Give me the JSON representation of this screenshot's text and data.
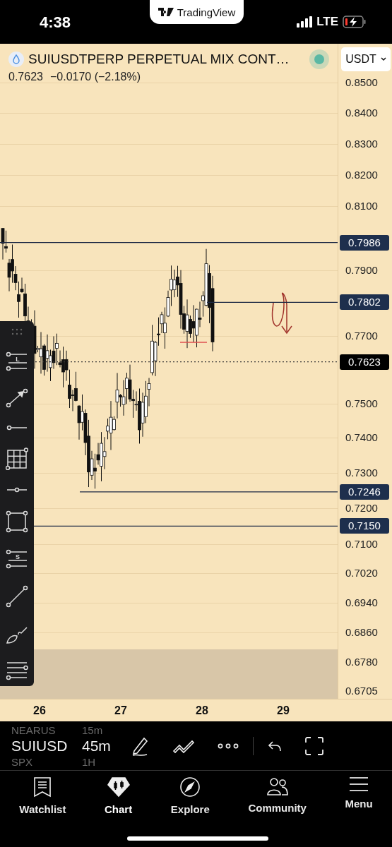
{
  "status_bar": {
    "time": "4:38",
    "app_pill": "TradingView",
    "network": "LTE"
  },
  "header": {
    "title": "SUIUSDTPERP PERPETUAL MIX CONT…",
    "price": "0.7623",
    "change": "−0.0170 (−2.18%)",
    "currency": "USDT"
  },
  "price_axis": [
    "0.8500",
    "0.8400",
    "0.8300",
    "0.8200",
    "0.8100",
    "0.7900",
    "0.7700",
    "0.7500",
    "0.7400",
    "0.7300",
    "0.7200",
    "0.7100",
    "0.7020",
    "0.6940",
    "0.6860",
    "0.6780",
    "0.6705"
  ],
  "price_tags": [
    {
      "label": "0.7986",
      "kind": "line"
    },
    {
      "label": "0.7802",
      "kind": "line"
    },
    {
      "label": "0.7623",
      "kind": "last"
    },
    {
      "label": "0.7246",
      "kind": "line"
    },
    {
      "label": "0.7150",
      "kind": "line"
    }
  ],
  "date_axis": [
    "26",
    "27",
    "28",
    "29"
  ],
  "drawing_tools": [
    {
      "kind": "lines",
      "badge": "L"
    },
    {
      "kind": "arrow"
    },
    {
      "kind": "ray"
    },
    {
      "kind": "grid"
    },
    {
      "kind": "point"
    },
    {
      "kind": "rect"
    },
    {
      "kind": "lines",
      "badge": "S"
    },
    {
      "kind": "segment"
    },
    {
      "kind": "brush"
    },
    {
      "kind": "list"
    }
  ],
  "picker": {
    "symbol_above": "NEARUS",
    "symbol": "SUIUSD",
    "symbol_below": "SPX",
    "interval_above": "15m",
    "interval": "45m",
    "interval_below": "1H"
  },
  "nav": [
    {
      "label": "Watchlist",
      "selected": false
    },
    {
      "label": "Chart",
      "selected": true
    },
    {
      "label": "Explore",
      "selected": false
    },
    {
      "label": "Community",
      "selected": false
    },
    {
      "label": "Menu",
      "selected": false
    }
  ]
}
